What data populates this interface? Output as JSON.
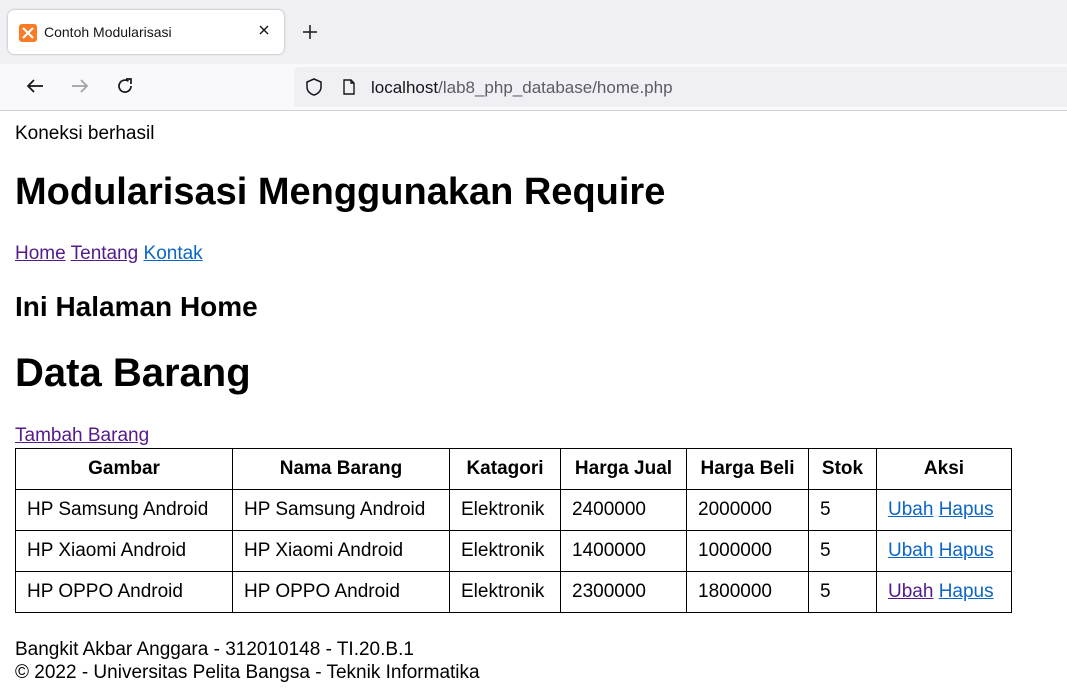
{
  "browser": {
    "tab_title": "Contoh Modularisasi",
    "url_host": "localhost",
    "url_path": "/lab8_php_database/home.php"
  },
  "page": {
    "status": "Koneksi berhasil",
    "main_heading": "Modularisasi Menggunakan Require",
    "menu": [
      {
        "label": "Home"
      },
      {
        "label": "Tentang"
      },
      {
        "label": "Kontak"
      }
    ],
    "sub_heading": "Ini Halaman Home",
    "data_heading": "Data Barang",
    "add_link": "Tambah Barang"
  },
  "table": {
    "headers": [
      "Gambar",
      "Nama Barang",
      "Katagori",
      "Harga Jual",
      "Harga Beli",
      "Stok",
      "Aksi"
    ],
    "rows": [
      {
        "gambar": "HP Samsung Android",
        "nama": "HP Samsung Android",
        "kategori": "Elektronik",
        "harga_jual": "2400000",
        "harga_beli": "2000000",
        "stok": "5",
        "ubah": "Ubah",
        "hapus": "Hapus"
      },
      {
        "gambar": "HP Xiaomi Android",
        "nama": "HP Xiaomi Android",
        "kategori": "Elektronik",
        "harga_jual": "1400000",
        "harga_beli": "1000000",
        "stok": "5",
        "ubah": "Ubah",
        "hapus": "Hapus"
      },
      {
        "gambar": "HP OPPO Android",
        "nama": "HP OPPO Android",
        "kategori": "Elektronik",
        "harga_jual": "2300000",
        "harga_beli": "1800000",
        "stok": "5",
        "ubah": "Ubah",
        "hapus": "Hapus"
      }
    ]
  },
  "footer": {
    "line1": "Bangkit Akbar Anggara - 312010148 - TI.20.B.1",
    "line2": "© 2022 - Universitas Pelita Bangsa - Teknik Informatika"
  },
  "icons": {
    "favicon": "xampp-icon",
    "close": "close-icon",
    "new_tab": "plus-icon",
    "back": "back-arrow-icon",
    "forward": "forward-arrow-icon",
    "reload": "reload-icon",
    "shield": "shield-icon",
    "page": "page-icon"
  },
  "colors": {
    "link": "#0b66c7",
    "visited_link": "#551a8b",
    "favicon": "#fb7a24"
  }
}
